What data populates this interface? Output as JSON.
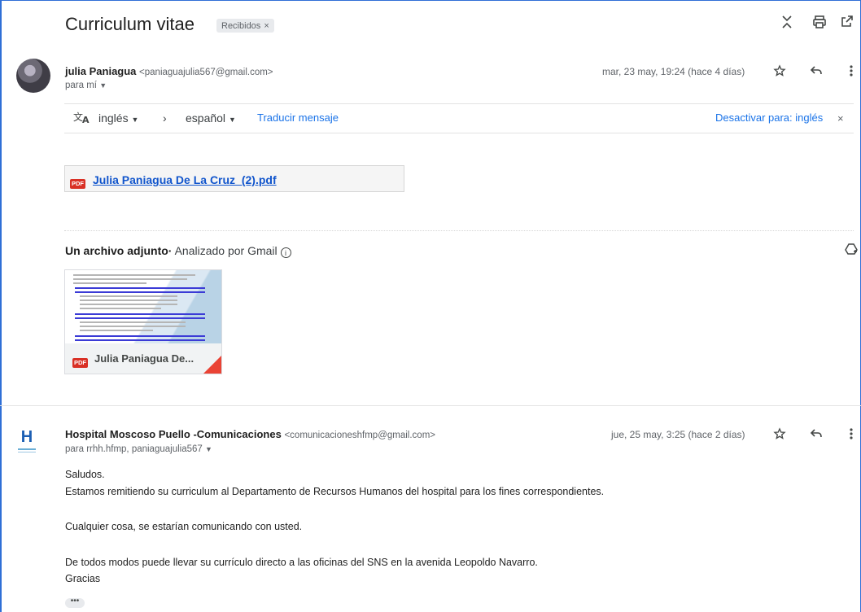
{
  "thread": {
    "subject": "Curriculum vitae",
    "label": "Recibidos",
    "label_close": "×"
  },
  "header_icons": {
    "collapse": "⌄",
    "print": "🖶",
    "popout": "⧉"
  },
  "message1": {
    "sender_name": "julia Paniagua",
    "sender_email": "<paniaguajulia567@gmail.com>",
    "to": "para mí",
    "date": "mar, 23 may, 19:24 (hace 4 días)"
  },
  "translate": {
    "from_lang": "inglés",
    "to_lang": "español",
    "translate_link": "Traducir mensaje",
    "disable_link": "Desactivar para: inglés",
    "close": "×"
  },
  "attachment_link": {
    "badge": "PDF",
    "filename": "Julia Paniagua De La Cruz_(2).pdf"
  },
  "attachments": {
    "title": "Un archivo adjunto",
    "scanned": "Analizado por Gmail",
    "thumb_name": "Julia Paniagua De...",
    "thumb_badge": "PDF"
  },
  "message2": {
    "sender_name": "Hospital Moscoso Puello -Comunicaciones",
    "sender_email": "<comunicacioneshfmp@gmail.com>",
    "to": "para rrhh.hfmp, paniaguajulia567",
    "date": "jue, 25 may, 3:25 (hace 2 días)",
    "avatar_letter": "H",
    "body": [
      "Saludos.",
      "Estamos remitiendo su curriculum al Departamento de Recursos Humanos del hospital para los fines correspondientes.",
      "Cualquier cosa, se estarían comunicando con usted.",
      "De todos modos puede llevar su currículo directo a las oficinas del SNS en la avenida Leopoldo Navarro.",
      "Gracias"
    ],
    "more": "•••"
  },
  "colors": {
    "link": "#1155cc",
    "accent": "#1a73e8",
    "pdf_red": "#d93025"
  }
}
